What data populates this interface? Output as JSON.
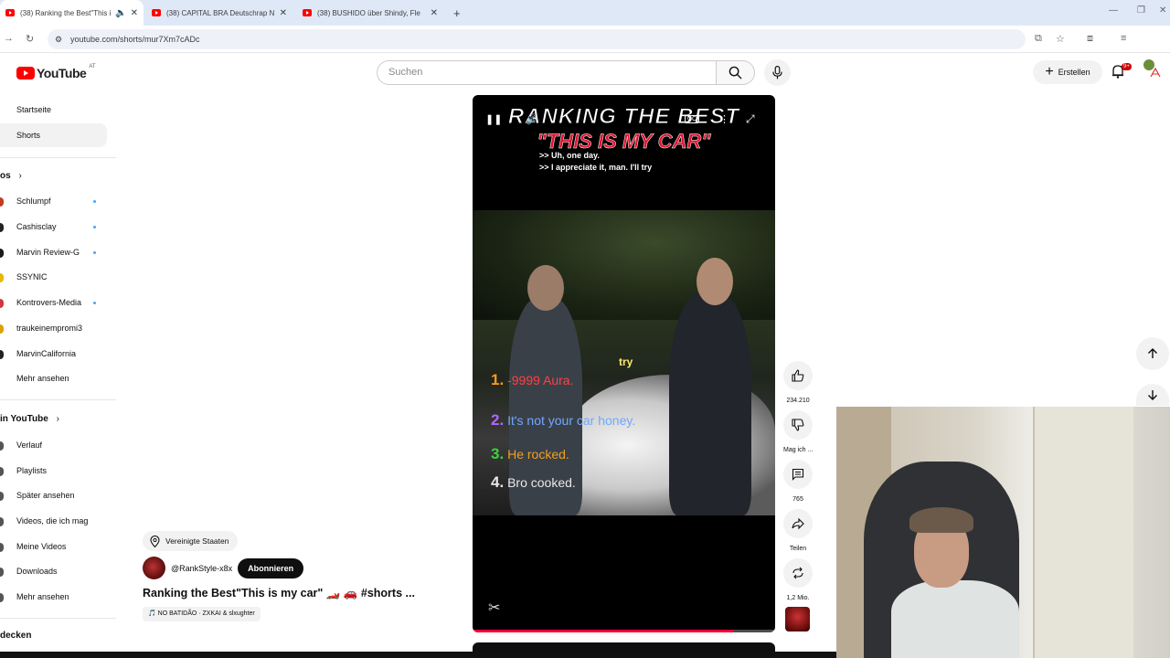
{
  "browser": {
    "tabs": [
      {
        "title": "(38) Ranking the Best\"This i",
        "active": true
      },
      {
        "title": "(38) CAPITAL BRA Deutschrap N"
      },
      {
        "title": "(38) BUSHIDO über Shindy, Fle"
      }
    ],
    "new_tab": "+",
    "url": "youtube.com/shorts/mur7Xm7cADc"
  },
  "header": {
    "logo_text": "YouTube",
    "country_code": "AT",
    "search_placeholder": "Suchen",
    "create_label": "Erstellen",
    "notification_count": "9+"
  },
  "sidebar": {
    "top": [
      {
        "label": "Startseite"
      },
      {
        "label": "Shorts",
        "selected": true
      }
    ],
    "subs_header": "os",
    "subscriptions": [
      {
        "label": "Schlumpf",
        "dot": true,
        "color": "#c23b22"
      },
      {
        "label": "Cashisclay",
        "dot": true,
        "color": "#222222"
      },
      {
        "label": "Marvin Review-G",
        "dot": true,
        "color": "#1a1a1a"
      },
      {
        "label": "SSYNIC",
        "dot": false,
        "color": "#e6b800"
      },
      {
        "label": "Kontrovers-Media",
        "dot": true,
        "color": "#d63636"
      },
      {
        "label": "traukeinempromi3",
        "dot": false,
        "color": "#e0a000"
      },
      {
        "label": "MarvinCalifornia",
        "dot": false,
        "color": "#222222"
      },
      {
        "label": "Mehr ansehen"
      }
    ],
    "you_header": "in YouTube",
    "you_items": [
      {
        "label": "Verlauf"
      },
      {
        "label": "Playlists"
      },
      {
        "label": "Später ansehen"
      },
      {
        "label": "Videos, die ich mag"
      },
      {
        "label": "Meine Videos"
      },
      {
        "label": "Downloads"
      },
      {
        "label": "Mehr ansehen"
      }
    ],
    "explore_header": "decken"
  },
  "video": {
    "overlay_title1": "RANKING THE BEST",
    "overlay_title2": "\"THIS IS MY CAR\"",
    "caption1": ">> Uh, one day.",
    "caption2": ">> I appreciate it, man. I'll try",
    "subtitle": "try",
    "ranks": [
      {
        "num": "1.",
        "text": "-9999 Aura.",
        "color": "#ff4040",
        "numcolor": "#ff9a1a"
      },
      {
        "num": "2.",
        "text": "It's not your car honey.",
        "color": "#6fa8ff",
        "numcolor": "#b066ff"
      },
      {
        "num": "3.",
        "text": "He rocked.",
        "color": "#f0a020",
        "numcolor": "#3ed13e"
      },
      {
        "num": "4.",
        "text": "Bro cooked.",
        "color": "#e8e8e8",
        "numcolor": "#e8e8e8"
      }
    ],
    "progress": 0.86
  },
  "actions": {
    "likes": "234.210",
    "dislike": "Mag ich ...",
    "comments": "765",
    "share": "Teilen",
    "remix": "1,2 Mio."
  },
  "meta": {
    "location": "Vereinigte Staaten",
    "channel": "@RankStyle-x8x",
    "subscribe": "Abonnieren",
    "title": "Ranking the Best\"This is my car\" 🏎️ 🚗 #shorts ...",
    "music": "🎵 NO BATIDÃO · ZXKAI & slxughter"
  }
}
